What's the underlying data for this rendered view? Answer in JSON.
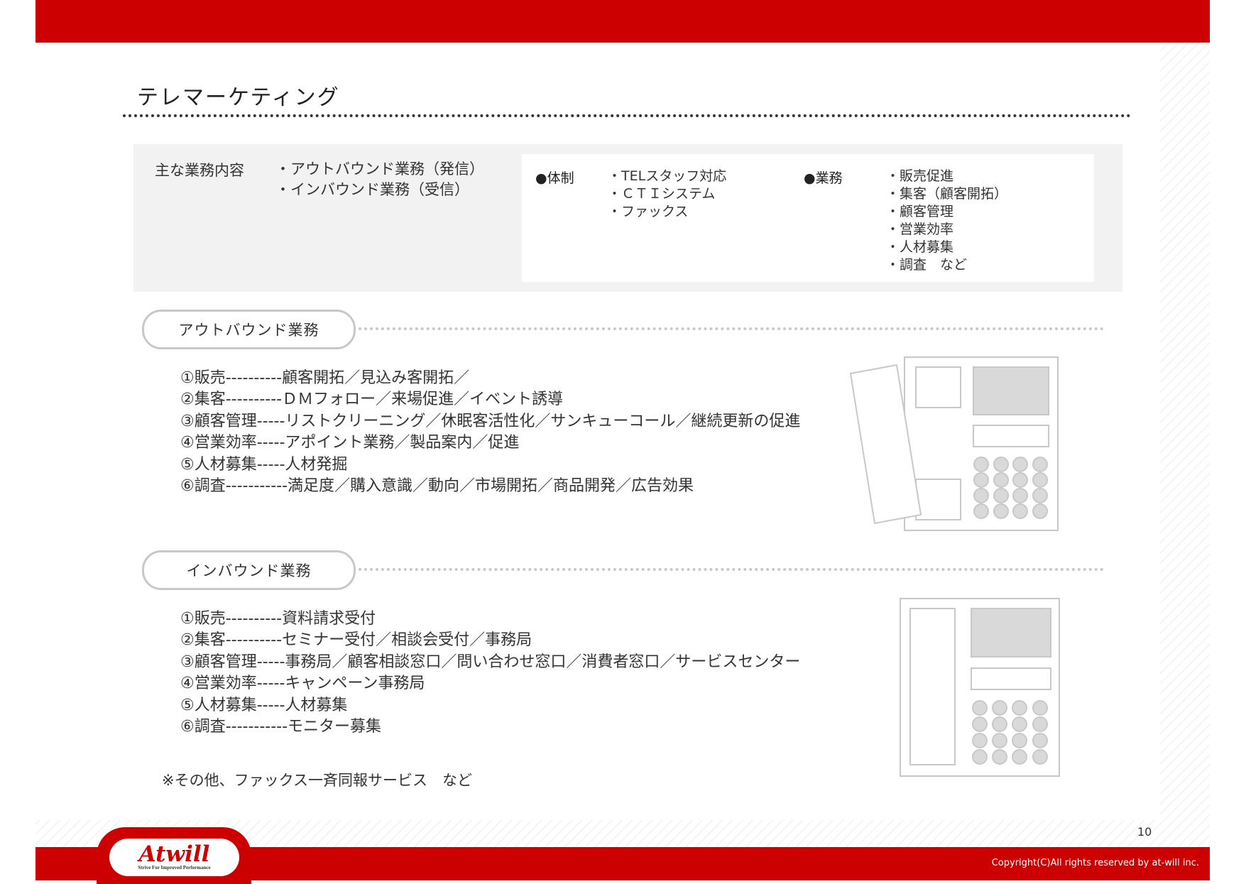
{
  "title": "テレマーケティング",
  "summary": {
    "label": "主な業務内容",
    "items": [
      "・アウトバウンド業務（発信）",
      "・インバウンド業務（受信）"
    ],
    "system_heading": "●体制",
    "system_items": [
      "・TELスタッフ対応",
      "・ＣＴＩシステム",
      "・ファックス"
    ],
    "business_heading": "●業務",
    "business_items": [
      "・販売促進",
      "・集客（顧客開拓）",
      "・顧客管理",
      "・営業効率",
      "・人材募集",
      "・調査　など"
    ]
  },
  "outbound": {
    "heading": "アウトバウンド業務",
    "items": [
      "①販売----------顧客開拓／見込み客開拓／",
      "②集客----------ＤＭフォロー／来場促進／イベント誘導",
      "③顧客管理-----リストクリーニング／休眠客活性化／サンキューコール／継続更新の促進",
      "④営業効率-----アポイント業務／製品案内／促進",
      "⑤人材募集-----人材発掘",
      "⑥調査-----------満足度／購入意識／動向／市場開拓／商品開発／広告効果"
    ]
  },
  "inbound": {
    "heading": "インバウンド業務",
    "items": [
      "①販売----------資料請求受付",
      "②集客----------セミナー受付／相談会受付／事務局",
      "③顧客管理-----事務局／顧客相談窓口／問い合わせ窓口／消費者窓口／サービスセンター",
      "④営業効率-----キャンペーン事務局",
      "⑤人材募集-----人材募集",
      "⑥調査-----------モニター募集"
    ]
  },
  "note": "※その他、ファックス一斉同報サービス　など",
  "page_number": "10",
  "copyright": "Copyright(C)All rights reserved by at-will inc.",
  "logo": {
    "text": "Atwill",
    "tagline": "Strive For Improved Performance"
  },
  "colors": {
    "brand_red": "#cc0000",
    "summary_bg": "#f2f2f2",
    "phone_screen": "#d9d9d9",
    "outline_gray": "#c8c8c8"
  },
  "icons": [
    "handset-lifted-phone-icon",
    "phone-on-hook-icon"
  ]
}
